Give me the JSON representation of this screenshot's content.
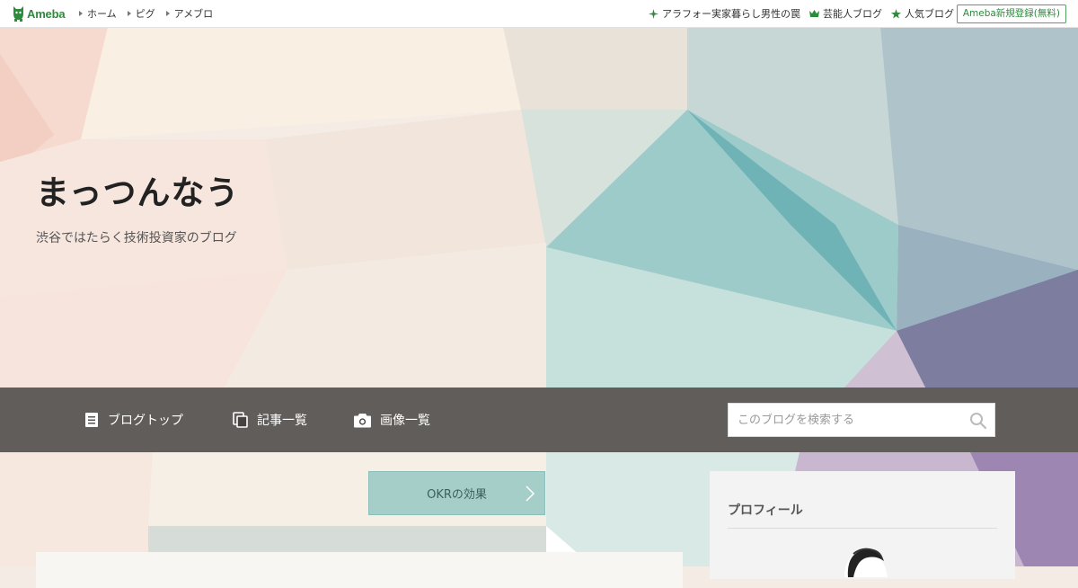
{
  "ameba": {
    "logo_text": "Ameba",
    "nav_left": [
      "ホーム",
      "ピグ",
      "アメブロ"
    ],
    "nav_right": [
      {
        "icon": "sparkle-icon",
        "label": "アラフォー実家暮らし男性の罠"
      },
      {
        "icon": "crown-icon",
        "label": "芸能人ブログ"
      },
      {
        "icon": "star-icon",
        "label": "人気ブログ"
      }
    ],
    "signup_label": "Ameba新規登録(無料)",
    "brand_color": "#2d8c3c"
  },
  "blog": {
    "title": "まっつんなう",
    "description": "渋谷ではたらく技術投資家のブログ"
  },
  "nav": {
    "items": [
      {
        "icon": "document-icon",
        "label": "ブログトップ"
      },
      {
        "icon": "copy-icon",
        "label": "記事一覧"
      },
      {
        "icon": "camera-icon",
        "label": "画像一覧"
      }
    ],
    "search_placeholder": "このブログを検索する"
  },
  "content": {
    "topic_button_label": "OKRの効果"
  },
  "sidebar": {
    "profile_heading": "プロフィール"
  }
}
